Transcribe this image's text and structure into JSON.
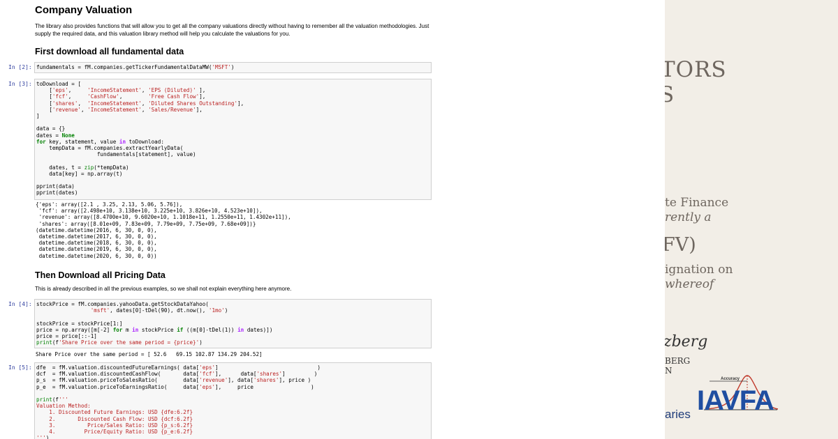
{
  "notebook": {
    "title": "Company Valuation",
    "intro": "The library also provides functions that will allow you to get all the company valuations directly without having to remember all the valuation methodologies. Just supply the required data, and this valuation library method will help you calculate the valuations for you.",
    "section1": "First download all fundamental data",
    "section2": "Then Download all Pricing Data",
    "section2_note": "This is already described in all the previous examples, so we shall not explain everything here anymore.",
    "cells": [
      {
        "prompt": "In [2]:"
      },
      {
        "prompt": "In [3]:"
      },
      {
        "prompt": "In [4]:"
      },
      {
        "prompt": "In [5]:"
      }
    ],
    "outputs": {
      "cell3": "{'eps': array([2.1 , 3.25, 2.13, 5.06, 5.76]),\n 'fcf': array([2.498e+10, 3.138e+10, 3.225e+10, 3.826e+10, 4.523e+10]),\n 'revenue': array([8.4700e+10, 9.6020e+10, 1.1018e+11, 1.2550e+11, 1.4302e+11]),\n 'shares': array([8.01e+09, 7.83e+09, 7.79e+09, 7.75e+09, 7.68e+09])}\n(datetime.datetime(2016, 6, 30, 0, 0),\n datetime.datetime(2017, 6, 30, 0, 0),\n datetime.datetime(2018, 6, 30, 0, 0),\n datetime.datetime(2019, 6, 30, 0, 0),\n datetime.datetime(2020, 6, 30, 0, 0))",
      "cell4": "Share Price over the same period = [ 52.6   69.15 102.87 134.29 204.52]"
    }
  },
  "cover": {
    "line_tors": "TORS",
    "line_s": "S",
    "line_finance": "te Finance",
    "line_rently": "rently a",
    "line_v": "FV)",
    "line_ignation": "ignation on",
    "line_whereof": "whereof",
    "signature": "zberg",
    "line_berg": "BERG",
    "line_n": "N",
    "line_aries": "aries",
    "accuracy_label": "Accuracy",
    "logo": "IAVFA",
    "colors": {
      "logo": "#1f4ea1",
      "curve": "#c0392b",
      "text": "#6e665f",
      "background": "#f2eee7"
    }
  }
}
